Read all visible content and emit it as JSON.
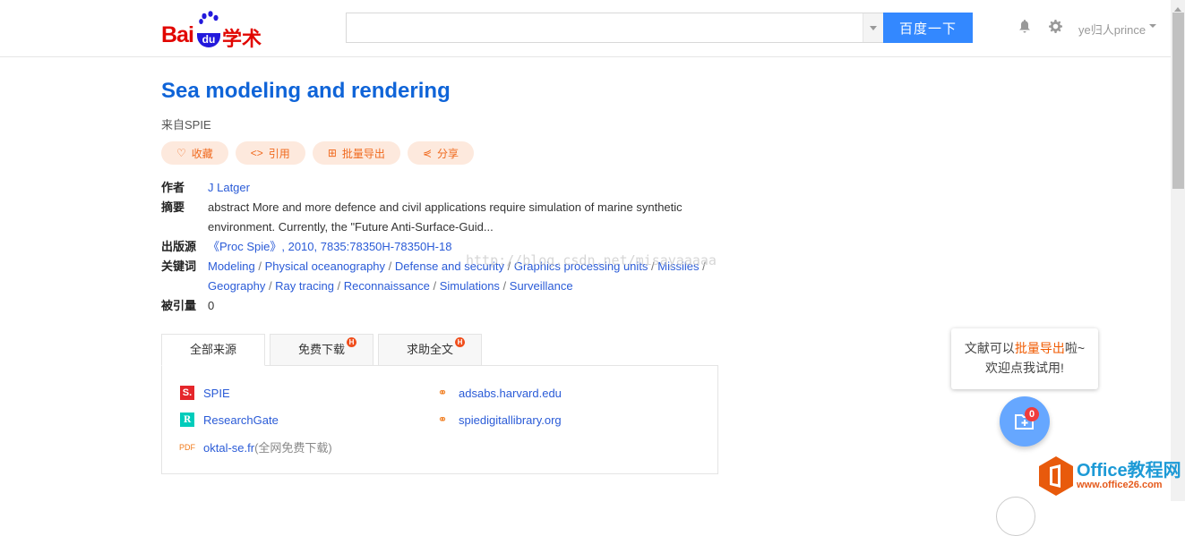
{
  "header": {
    "logo_text": "Bai du 学术",
    "search": {
      "value": "",
      "placeholder": ""
    },
    "search_button": "百度一下",
    "user": "ye归人prince",
    "icons": [
      "bell-icon",
      "gear-icon"
    ]
  },
  "paper": {
    "title": "Sea modeling and rendering",
    "from": "来自SPIE",
    "actions": [
      {
        "label": "收藏",
        "icon": "heart-icon"
      },
      {
        "label": "引用",
        "icon": "code-icon"
      },
      {
        "label": "批量导出",
        "icon": "folder-plus-icon"
      },
      {
        "label": "分享",
        "icon": "share-icon"
      }
    ],
    "meta": {
      "author_label": "作者",
      "author": "J Latger",
      "abstract_label": "摘要",
      "abstract_line1": "abstract More and more defence and civil applications require simulation of marine synthetic",
      "abstract_line2": "environment. Currently, the \"Future Anti-Surface-Guid...",
      "source_label": "出版源",
      "source": "《Proc Spie》, 2010, 7835:78350H-78350H-18",
      "keywords_label": "关键词",
      "keywords": [
        "Modeling",
        "Physical oceanography",
        "Defense and security",
        "Graphics processing units",
        "Missiles",
        "Geography",
        "Ray tracing",
        "Reconnaissance",
        "Simulations",
        "Surveillance"
      ],
      "cited_label": "被引量",
      "cited": "0"
    }
  },
  "watermark": "http://blog.csdn.net/misayaaaaa",
  "tabs": [
    {
      "label": "全部来源",
      "active": true
    },
    {
      "label": "免费下载",
      "badge": "H"
    },
    {
      "label": "求助全文",
      "badge": "H"
    }
  ],
  "sources": [
    {
      "name": "SPIE",
      "icon": "spie-logo-icon",
      "color": "#e5262b"
    },
    {
      "name": "ResearchGate",
      "icon": "researchgate-logo-icon",
      "color": "#00ccbb"
    },
    {
      "name": "oktal-se.fr",
      "note": "(全网免费下载)",
      "icon": "pdf-icon"
    },
    {
      "name": "adsabs.harvard.edu",
      "icon": "link-icon"
    },
    {
      "name": "spiedigitallibrary.org",
      "icon": "link-icon"
    }
  ],
  "tip": {
    "pre": "文献可以",
    "highlight": "批量导出",
    "post": "啦~",
    "line2": "欢迎点我试用!"
  },
  "fab": {
    "badge": "0"
  },
  "corner_watermark": {
    "line1": "Office教程网",
    "line2": "www.office26.com"
  },
  "colors": {
    "accent": "#3388ff",
    "title": "#0f64d8",
    "link": "#2a5bd7",
    "action": "#f06a1f",
    "action_bg": "#fde9dd"
  }
}
